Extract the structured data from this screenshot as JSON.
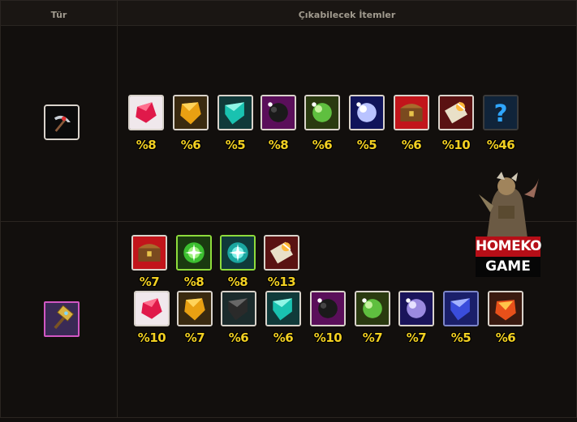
{
  "table": {
    "col_type_header": "Tür",
    "col_items_header": "Çıkabilecek İtemler"
  },
  "rows": [
    {
      "type_icon": "pickaxe-icon",
      "items": [
        {
          "icon": "red-crystal-icon",
          "pct": "%8"
        },
        {
          "icon": "orange-crystal-icon",
          "pct": "%6"
        },
        {
          "icon": "teal-crystal-icon",
          "pct": "%5"
        },
        {
          "icon": "dark-ore-icon",
          "pct": "%8"
        },
        {
          "icon": "green-gem-cluster-icon",
          "pct": "%6"
        },
        {
          "icon": "blue-gem-cluster-icon",
          "pct": "%5"
        },
        {
          "icon": "treasure-chest-icon",
          "pct": "%6"
        },
        {
          "icon": "magic-scroll-icon",
          "pct": "%10"
        },
        {
          "icon": "mystery-question-icon",
          "pct": "%46"
        }
      ]
    },
    {
      "type_icon": "golden-hammer-icon",
      "items_row1": [
        {
          "icon": "treasure-chest-icon",
          "pct": "%7"
        },
        {
          "icon": "green-orb-icon",
          "pct": "%8"
        },
        {
          "icon": "teal-orb-icon",
          "pct": "%8"
        },
        {
          "icon": "magic-scroll-icon",
          "pct": "%13"
        }
      ],
      "items_row2": [
        {
          "icon": "red-crystal-icon",
          "pct": "%10"
        },
        {
          "icon": "orange-crystal-icon",
          "pct": "%7"
        },
        {
          "icon": "black-crystal-icon",
          "pct": "%6"
        },
        {
          "icon": "teal-crystal-icon",
          "pct": "%6"
        },
        {
          "icon": "dark-ore-icon",
          "pct": "%10"
        },
        {
          "icon": "green-gem-cluster-icon",
          "pct": "%7"
        },
        {
          "icon": "violet-gem-cluster-icon",
          "pct": "%7"
        },
        {
          "icon": "blue-crystal-icon",
          "pct": "%5"
        },
        {
          "icon": "fire-gem-icon",
          "pct": "%6"
        }
      ]
    }
  ],
  "watermark": {
    "line1": "HOMEKO",
    "line2": "GAME"
  },
  "colors": {
    "percent_text": "#f2d021",
    "background": "#120f0d",
    "grid": "#2a2521"
  }
}
